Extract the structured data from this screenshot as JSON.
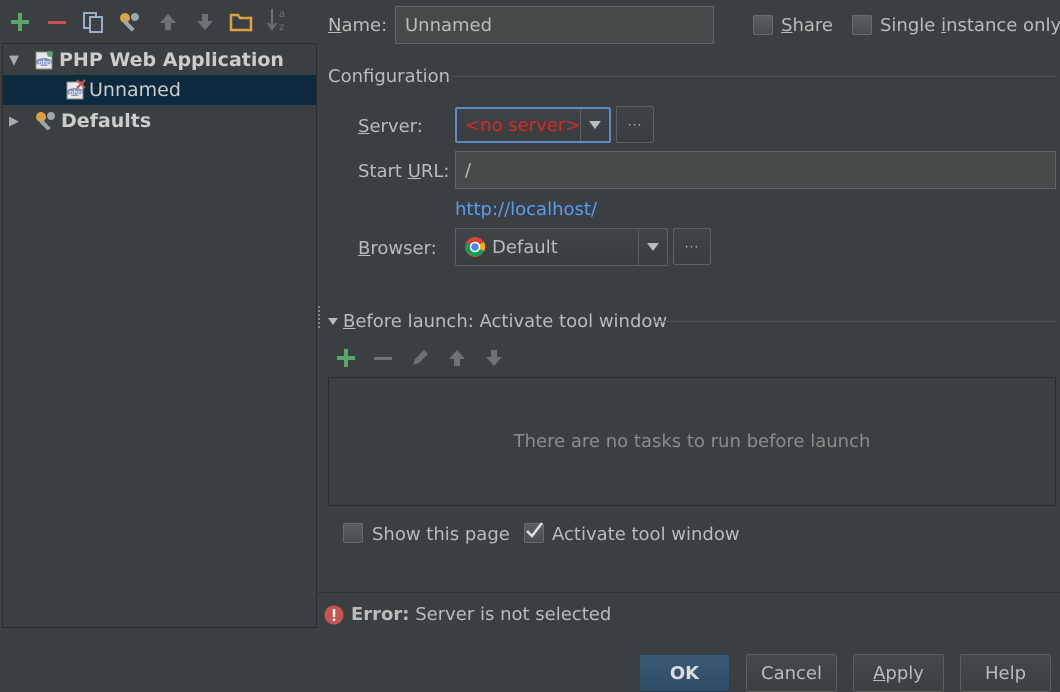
{
  "toolbar": {
    "icons": [
      "add-icon",
      "remove-icon",
      "copy-icon",
      "edit-defaults-icon",
      "move-up-icon",
      "move-down-icon",
      "folder-icon",
      "sort-icon"
    ]
  },
  "tree": {
    "items": [
      {
        "label": "PHP Web Application",
        "expanded": true
      },
      {
        "label": "Unnamed",
        "selected": true
      },
      {
        "label": "Defaults",
        "expanded": false
      }
    ]
  },
  "header": {
    "name_label_prefix": "",
    "name_label_u": "N",
    "name_label_rest": "ame:",
    "name_value": "Unnamed",
    "share_u": "S",
    "share_rest": "hare",
    "single_pre": "Single ",
    "single_u": "i",
    "single_rest": "nstance only"
  },
  "config": {
    "section_title": "Configuration",
    "server_u": "S",
    "server_rest": "erver:",
    "server_value": "<no server>",
    "start_url_pre": "Start ",
    "start_url_u": "U",
    "start_url_rest": "RL:",
    "start_url_value": "/",
    "url_link": "http://localhost/",
    "browser_u": "B",
    "browser_rest": "rowser:",
    "browser_value": "Default",
    "more": "···"
  },
  "before_launch": {
    "title_u": "B",
    "title_rest": "efore launch: Activate tool window",
    "empty_text": "There are no tasks to run before launch",
    "show_page": "Show this page",
    "activate_tool": "Activate tool window",
    "show_page_checked": false,
    "activate_tool_checked": true
  },
  "error": {
    "label": "Error:",
    "message": " Server is not selected"
  },
  "buttons": {
    "ok": "OK",
    "cancel": "Cancel",
    "apply_u": "A",
    "apply_rest": "pply",
    "help": "Help"
  },
  "colors": {
    "background": "#3c3f41",
    "selection": "#0d293e",
    "error_red": "#c75450",
    "link": "#589df6",
    "add_green": "#59a869"
  }
}
